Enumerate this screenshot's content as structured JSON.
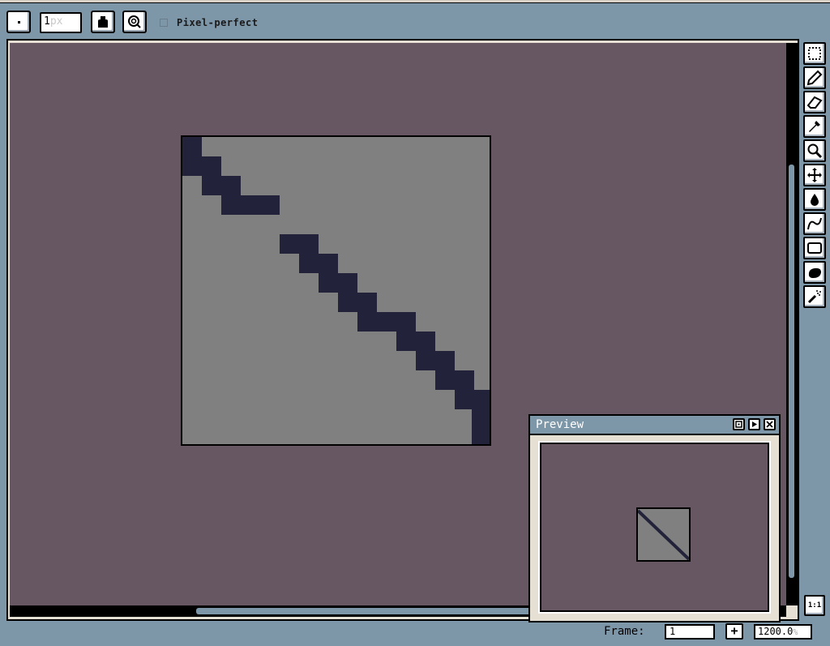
{
  "context_bar": {
    "brush_size_value": "1",
    "brush_size_unit": "px",
    "pixel_perfect_label": "Pixel-perfect",
    "pixel_perfect_checked": false
  },
  "toolbar": {
    "tools": [
      {
        "name": "marquee-tool",
        "icon": "marquee-icon"
      },
      {
        "name": "pencil-tool",
        "icon": "pencil-icon"
      },
      {
        "name": "eraser-tool",
        "icon": "eraser-icon"
      },
      {
        "name": "eyedropper-tool",
        "icon": "eyedropper-icon"
      },
      {
        "name": "zoom-tool",
        "icon": "magnifier-icon"
      },
      {
        "name": "move-tool",
        "icon": "move-arrows-icon"
      },
      {
        "name": "paint-bucket-tool",
        "icon": "paint-drop-icon"
      },
      {
        "name": "curve-tool",
        "icon": "curve-icon"
      },
      {
        "name": "rectangle-tool",
        "icon": "rectangle-icon"
      },
      {
        "name": "contour-tool",
        "icon": "blob-icon"
      },
      {
        "name": "blur-tool",
        "icon": "spray-icon"
      }
    ],
    "zoom_reset_label": "1:1"
  },
  "status_bar": {
    "frame_label": "Frame:",
    "frame_value": "1",
    "add_frame_label": "+",
    "zoom_value": "1200.0",
    "zoom_unit": "%"
  },
  "preview_window": {
    "title": "Preview"
  },
  "colors": {
    "ui_background": "#7d96a8",
    "canvas_background": "#665762",
    "sprite_background": "#808080",
    "stroke_color": "#22223a"
  }
}
